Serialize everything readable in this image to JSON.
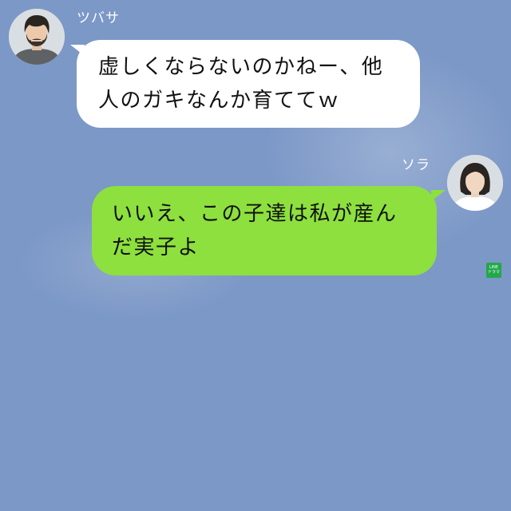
{
  "chat": {
    "background_color": "#7c98c7",
    "messages": [
      {
        "sender": "ツバサ",
        "side": "left",
        "avatar_icon": "man-avatar-icon",
        "lines": [
          "虚しくならないのかねー、他",
          "人のガキなんか育ててｗ"
        ],
        "bubble_color": "#ffffff"
      },
      {
        "sender": "ソラ",
        "side": "right",
        "avatar_icon": "woman-avatar-icon",
        "lines": [
          "いいえ、この子達は私が産ん",
          "だ実子よ"
        ],
        "bubble_color": "#8de03e"
      }
    ]
  },
  "watermark": {
    "line1": "LINE",
    "line2": "ドラマ",
    "color": "#22a84a"
  }
}
